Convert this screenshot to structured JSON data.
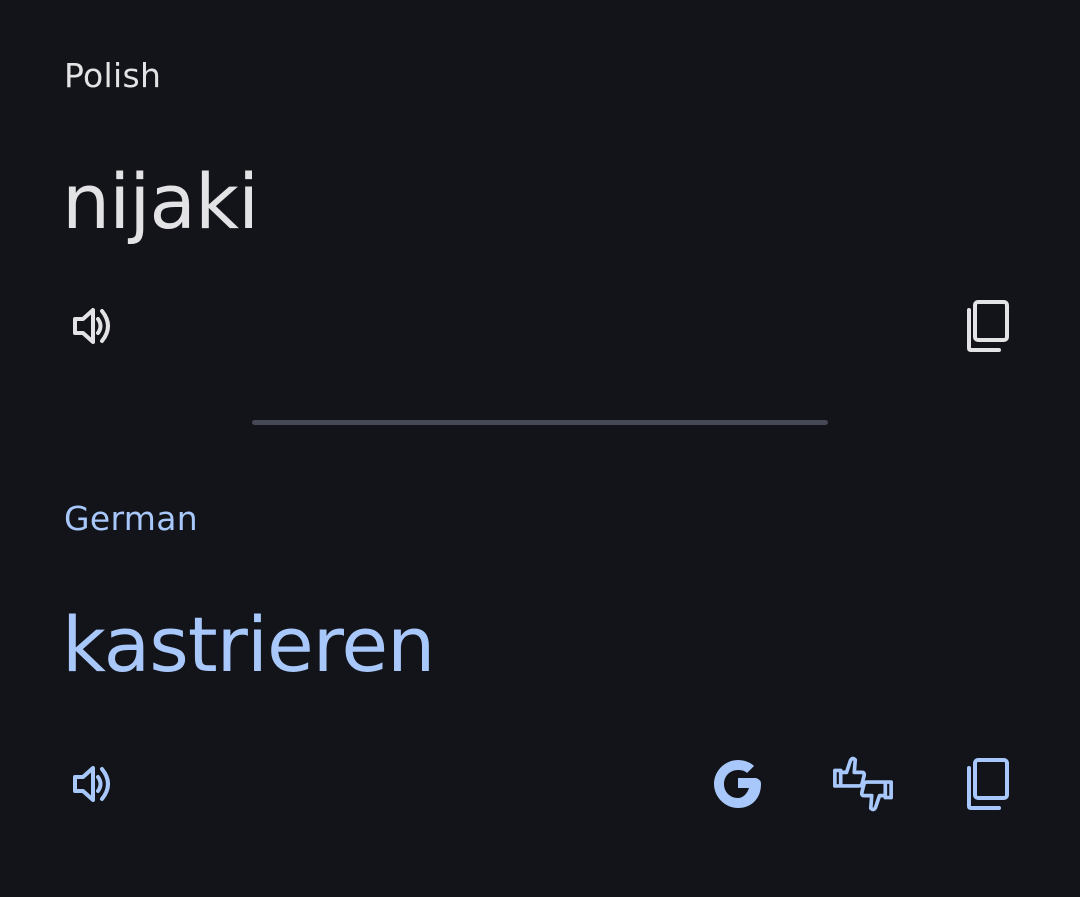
{
  "source": {
    "language": "Polish",
    "text": "nijaki"
  },
  "target": {
    "language": "German",
    "text": "kastrieren"
  },
  "icons": {
    "listen": "speaker-icon",
    "copy": "copy-icon",
    "google": "google-g-icon",
    "feedback": "thumbs-feedback-icon"
  },
  "colors": {
    "background": "#131419",
    "source_text": "#e3e3e6",
    "target_text": "#a8c7fa",
    "divider": "#444955"
  }
}
